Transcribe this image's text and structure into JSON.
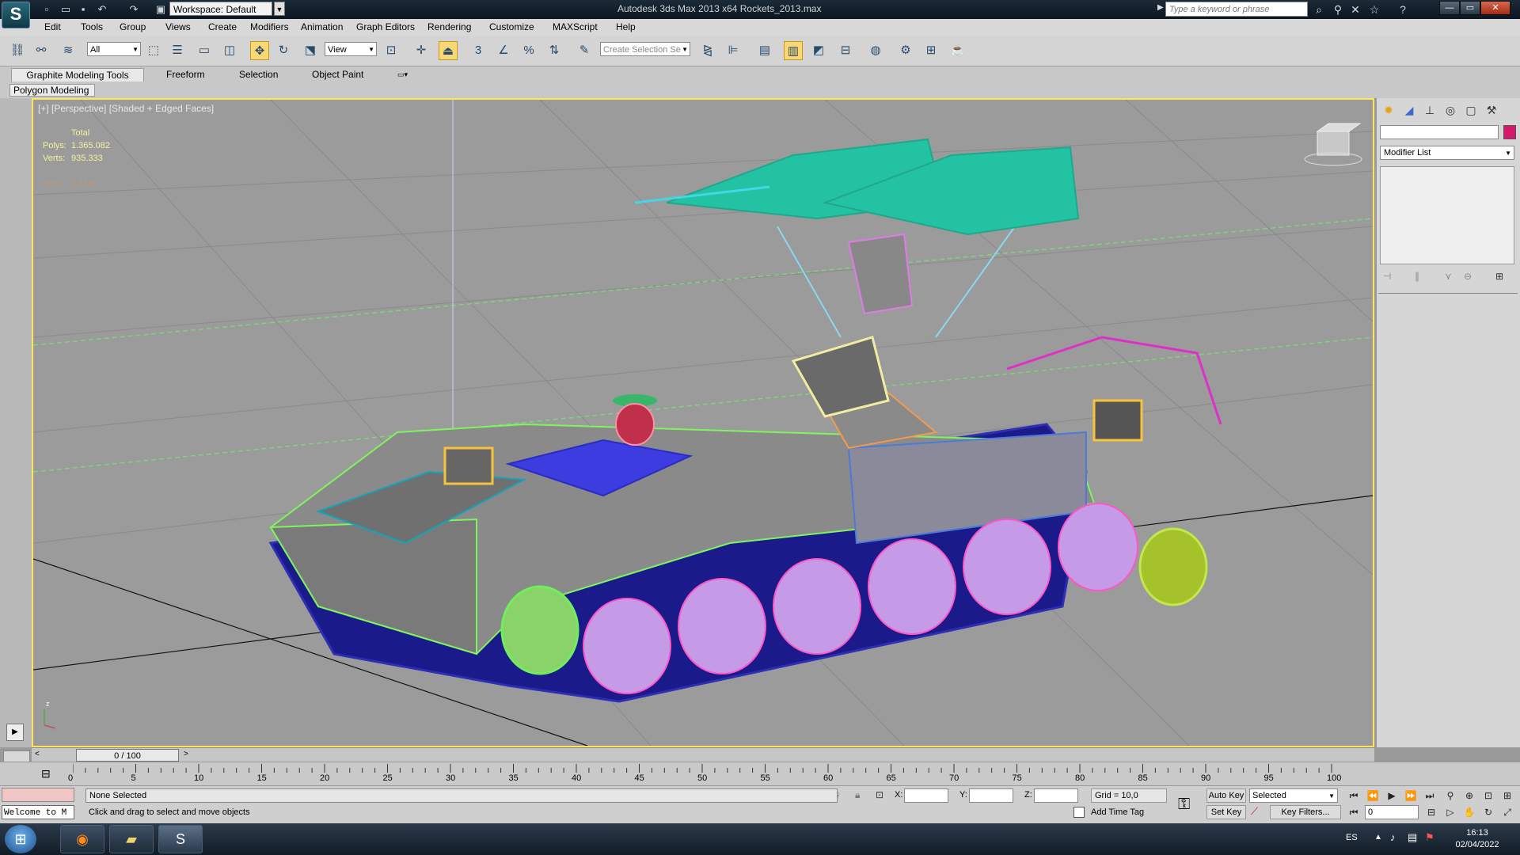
{
  "titlebar": {
    "app_logo": "S",
    "workspace": "Workspace: Default",
    "title": "Autodesk 3ds Max  2013 x64     Rockets_2013.max",
    "search_placeholder": "Type a keyword or phrase"
  },
  "menu": [
    "Edit",
    "Tools",
    "Group",
    "Views",
    "Create",
    "Modifiers",
    "Animation",
    "Graph Editors",
    "Rendering",
    "Customize",
    "MAXScript",
    "Help"
  ],
  "toolbar": {
    "selection_filter": "All",
    "ref_coord": "View",
    "snap_3": "3",
    "selection_set_placeholder": "Create Selection Se"
  },
  "ribbon": {
    "tabs": [
      "Graphite Modeling Tools",
      "Freeform",
      "Selection",
      "Object Paint"
    ],
    "subtab": "Polygon Modeling"
  },
  "viewport": {
    "label": "[+] [Perspective] [Shaded + Edged Faces]",
    "stats_total": "Total",
    "polys_label": "Polys:",
    "polys_value": "1.365.082",
    "verts_label": "Verts:",
    "verts_value": "935.333",
    "fps_label": "FPS:",
    "fps_value": "3.416"
  },
  "command_panel": {
    "modifier_list": "Modifier List",
    "object_color": "#d6176b"
  },
  "timeline": {
    "slider_label": "0 / 100",
    "ticks": [
      "0",
      "5",
      "10",
      "15",
      "20",
      "25",
      "30",
      "35",
      "40",
      "45",
      "50",
      "55",
      "60",
      "65",
      "70",
      "75",
      "80",
      "85",
      "90",
      "95",
      "100"
    ]
  },
  "status": {
    "welcome": "Welcome to M",
    "selection": "None Selected",
    "prompt": "Click and drag to select and move objects",
    "x_label": "X:",
    "y_label": "Y:",
    "z_label": "Z:",
    "grid": "Grid = 10,0",
    "add_time_tag": "Add Time Tag",
    "auto_key": "Auto Key",
    "set_key": "Set Key",
    "selected": "Selected",
    "key_filters": "Key Filters...",
    "frame": "0"
  },
  "taskbar": {
    "lang": "ES",
    "time": "16:13",
    "date": "02/04/2022"
  }
}
